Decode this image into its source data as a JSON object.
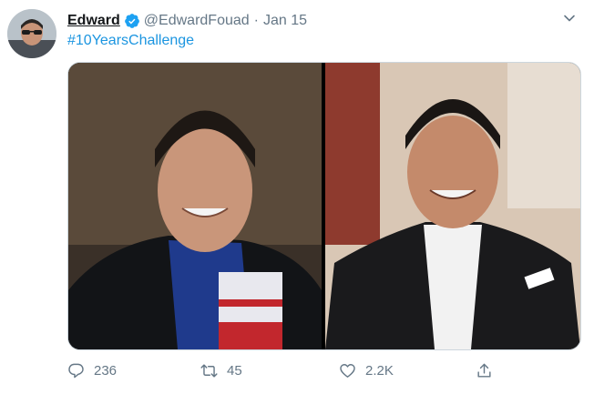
{
  "tweet": {
    "display_name": "Edward",
    "handle": "@EdwardFouad",
    "separator": "·",
    "date": "Jan 15",
    "text": "#10YearsChallenge"
  },
  "actions": {
    "replies": "236",
    "retweets": "45",
    "likes": "2.2K"
  },
  "icons": {
    "verified": "verified-badge-icon",
    "menu": "chevron-down-icon",
    "reply": "reply-icon",
    "retweet": "retweet-icon",
    "like": "heart-icon",
    "share": "share-icon"
  },
  "colors": {
    "link": "#1b95e0",
    "verified": "#1da1f2",
    "muted": "#657786"
  }
}
